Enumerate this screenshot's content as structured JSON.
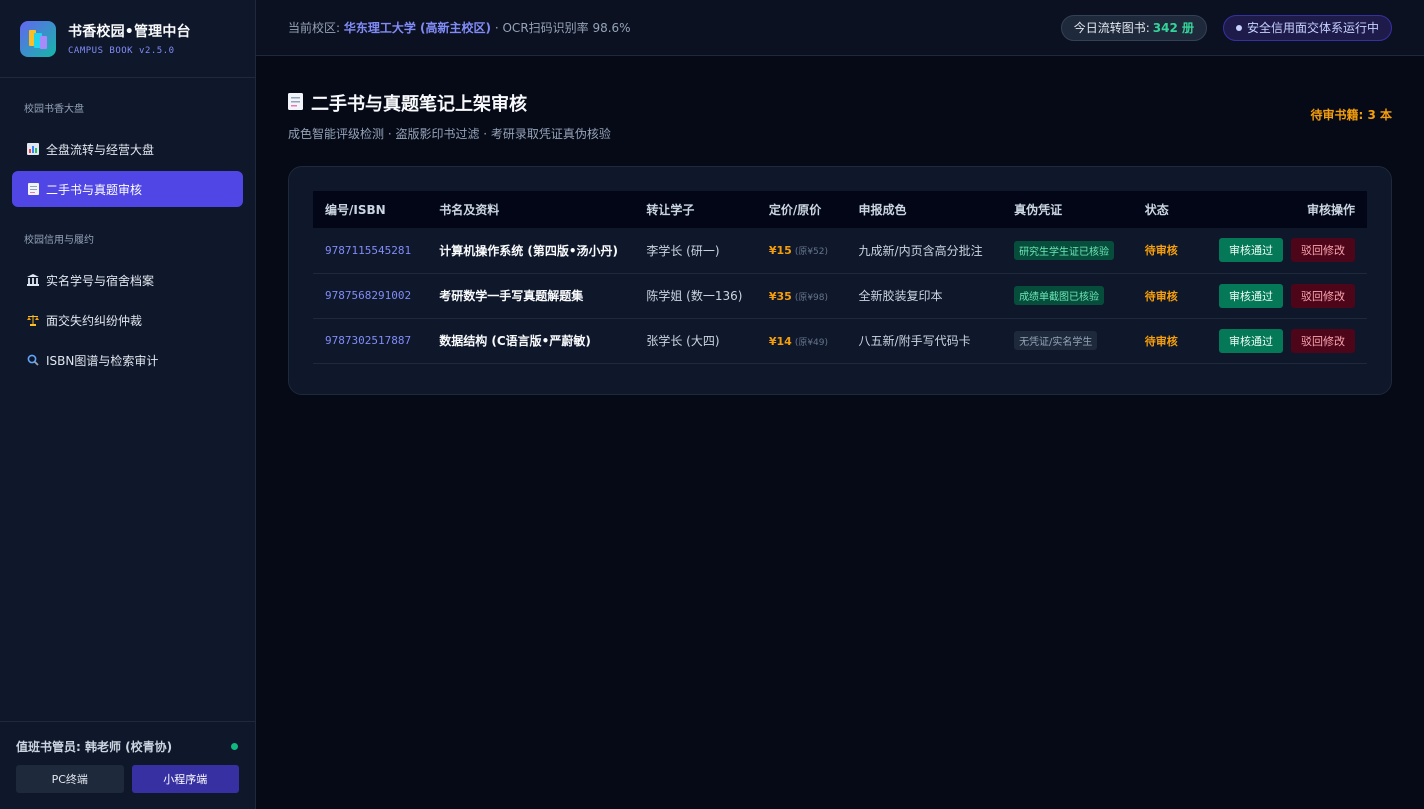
{
  "brand": {
    "title": "书香校园•管理中台",
    "subtitle": "CAMPUS BOOK v2.5.0"
  },
  "sidebar": {
    "groups": [
      {
        "title": "校园书香大盘",
        "items": [
          {
            "label": "全盘流转与经营大盘",
            "icon": "bar-chart-icon"
          },
          {
            "label": "二手书与真题审核",
            "icon": "document-icon",
            "active": true
          }
        ]
      },
      {
        "title": "校园信用与履约",
        "items": [
          {
            "label": "实名学号与宿舍档案",
            "icon": "bank-icon"
          },
          {
            "label": "面交失约纠纷仲裁",
            "icon": "scales-icon"
          },
          {
            "label": "ISBN图谱与检索审计",
            "icon": "magnifier-icon"
          }
        ]
      }
    ],
    "footer": {
      "duty": "值班书管员: 韩老师 (校青协)",
      "btn_pc": "PC终端",
      "btn_mini": "小程序端"
    }
  },
  "topbar": {
    "campus_prefix": "当前校区:",
    "campus_name": "华东理工大学 (高新主校区)",
    "campus_suffix": "· OCR扫码识别率 98.6%",
    "today_label": "今日流转图书:",
    "today_value": "342 册",
    "secure_label": "安全信用面交体系运行中"
  },
  "page": {
    "title": "二手书与真题笔记上架审核",
    "subtitle": "成色智能评级检测 · 盗版影印书过滤 · 考研录取凭证真伪核验",
    "pending": "待审书籍: 3 本"
  },
  "table": {
    "headers": [
      "编号/ISBN",
      "书名及资料",
      "转让学子",
      "定价/原价",
      "申报成色",
      "真伪凭证",
      "状态",
      "审核操作"
    ],
    "rows": [
      {
        "isbn": "9787115545281",
        "book": "计算机操作系统 (第四版•汤小丹)",
        "seller": "李学长 (研一)",
        "price": "¥15",
        "orig": "(原¥52)",
        "condition": "九成新/内页含高分批注",
        "proof": "研究生学生证已核验",
        "proof_style": "green",
        "status": "待审核",
        "approve": "审核通过",
        "reject": "驳回修改"
      },
      {
        "isbn": "9787568291002",
        "book": "考研数学一手写真题解题集",
        "seller": "陈学姐 (数一136)",
        "price": "¥35",
        "orig": "(原¥98)",
        "condition": "全新胶装复印本",
        "proof": "成绩单截图已核验",
        "proof_style": "green",
        "status": "待审核",
        "approve": "审核通过",
        "reject": "驳回修改"
      },
      {
        "isbn": "9787302517887",
        "book": "数据结构 (C语言版•严蔚敏)",
        "seller": "张学长 (大四)",
        "price": "¥14",
        "orig": "(原¥49)",
        "condition": "八五新/附手写代码卡",
        "proof": "无凭证/实名学生",
        "proof_style": "gray",
        "status": "待审核",
        "approve": "审核通过",
        "reject": "驳回修改"
      }
    ]
  },
  "colors": {
    "accent": "#4f46e5",
    "success": "#10b981",
    "warning": "#f59e0b",
    "danger": "#fda4af"
  }
}
